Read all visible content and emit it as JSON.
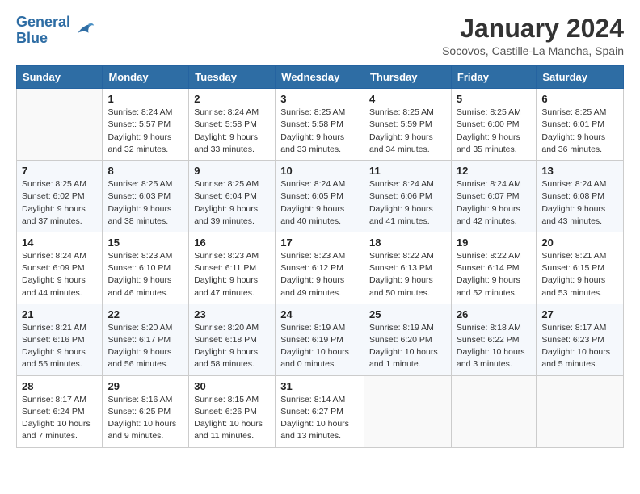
{
  "header": {
    "logo_line1": "General",
    "logo_line2": "Blue",
    "month_title": "January 2024",
    "location": "Socovos, Castille-La Mancha, Spain"
  },
  "weekdays": [
    "Sunday",
    "Monday",
    "Tuesday",
    "Wednesday",
    "Thursday",
    "Friday",
    "Saturday"
  ],
  "weeks": [
    [
      {
        "day": "",
        "info": ""
      },
      {
        "day": "1",
        "info": "Sunrise: 8:24 AM\nSunset: 5:57 PM\nDaylight: 9 hours\nand 32 minutes."
      },
      {
        "day": "2",
        "info": "Sunrise: 8:24 AM\nSunset: 5:58 PM\nDaylight: 9 hours\nand 33 minutes."
      },
      {
        "day": "3",
        "info": "Sunrise: 8:25 AM\nSunset: 5:58 PM\nDaylight: 9 hours\nand 33 minutes."
      },
      {
        "day": "4",
        "info": "Sunrise: 8:25 AM\nSunset: 5:59 PM\nDaylight: 9 hours\nand 34 minutes."
      },
      {
        "day": "5",
        "info": "Sunrise: 8:25 AM\nSunset: 6:00 PM\nDaylight: 9 hours\nand 35 minutes."
      },
      {
        "day": "6",
        "info": "Sunrise: 8:25 AM\nSunset: 6:01 PM\nDaylight: 9 hours\nand 36 minutes."
      }
    ],
    [
      {
        "day": "7",
        "info": "Sunrise: 8:25 AM\nSunset: 6:02 PM\nDaylight: 9 hours\nand 37 minutes."
      },
      {
        "day": "8",
        "info": "Sunrise: 8:25 AM\nSunset: 6:03 PM\nDaylight: 9 hours\nand 38 minutes."
      },
      {
        "day": "9",
        "info": "Sunrise: 8:25 AM\nSunset: 6:04 PM\nDaylight: 9 hours\nand 39 minutes."
      },
      {
        "day": "10",
        "info": "Sunrise: 8:24 AM\nSunset: 6:05 PM\nDaylight: 9 hours\nand 40 minutes."
      },
      {
        "day": "11",
        "info": "Sunrise: 8:24 AM\nSunset: 6:06 PM\nDaylight: 9 hours\nand 41 minutes."
      },
      {
        "day": "12",
        "info": "Sunrise: 8:24 AM\nSunset: 6:07 PM\nDaylight: 9 hours\nand 42 minutes."
      },
      {
        "day": "13",
        "info": "Sunrise: 8:24 AM\nSunset: 6:08 PM\nDaylight: 9 hours\nand 43 minutes."
      }
    ],
    [
      {
        "day": "14",
        "info": "Sunrise: 8:24 AM\nSunset: 6:09 PM\nDaylight: 9 hours\nand 44 minutes."
      },
      {
        "day": "15",
        "info": "Sunrise: 8:23 AM\nSunset: 6:10 PM\nDaylight: 9 hours\nand 46 minutes."
      },
      {
        "day": "16",
        "info": "Sunrise: 8:23 AM\nSunset: 6:11 PM\nDaylight: 9 hours\nand 47 minutes."
      },
      {
        "day": "17",
        "info": "Sunrise: 8:23 AM\nSunset: 6:12 PM\nDaylight: 9 hours\nand 49 minutes."
      },
      {
        "day": "18",
        "info": "Sunrise: 8:22 AM\nSunset: 6:13 PM\nDaylight: 9 hours\nand 50 minutes."
      },
      {
        "day": "19",
        "info": "Sunrise: 8:22 AM\nSunset: 6:14 PM\nDaylight: 9 hours\nand 52 minutes."
      },
      {
        "day": "20",
        "info": "Sunrise: 8:21 AM\nSunset: 6:15 PM\nDaylight: 9 hours\nand 53 minutes."
      }
    ],
    [
      {
        "day": "21",
        "info": "Sunrise: 8:21 AM\nSunset: 6:16 PM\nDaylight: 9 hours\nand 55 minutes."
      },
      {
        "day": "22",
        "info": "Sunrise: 8:20 AM\nSunset: 6:17 PM\nDaylight: 9 hours\nand 56 minutes."
      },
      {
        "day": "23",
        "info": "Sunrise: 8:20 AM\nSunset: 6:18 PM\nDaylight: 9 hours\nand 58 minutes."
      },
      {
        "day": "24",
        "info": "Sunrise: 8:19 AM\nSunset: 6:19 PM\nDaylight: 10 hours\nand 0 minutes."
      },
      {
        "day": "25",
        "info": "Sunrise: 8:19 AM\nSunset: 6:20 PM\nDaylight: 10 hours\nand 1 minute."
      },
      {
        "day": "26",
        "info": "Sunrise: 8:18 AM\nSunset: 6:22 PM\nDaylight: 10 hours\nand 3 minutes."
      },
      {
        "day": "27",
        "info": "Sunrise: 8:17 AM\nSunset: 6:23 PM\nDaylight: 10 hours\nand 5 minutes."
      }
    ],
    [
      {
        "day": "28",
        "info": "Sunrise: 8:17 AM\nSunset: 6:24 PM\nDaylight: 10 hours\nand 7 minutes."
      },
      {
        "day": "29",
        "info": "Sunrise: 8:16 AM\nSunset: 6:25 PM\nDaylight: 10 hours\nand 9 minutes."
      },
      {
        "day": "30",
        "info": "Sunrise: 8:15 AM\nSunset: 6:26 PM\nDaylight: 10 hours\nand 11 minutes."
      },
      {
        "day": "31",
        "info": "Sunrise: 8:14 AM\nSunset: 6:27 PM\nDaylight: 10 hours\nand 13 minutes."
      },
      {
        "day": "",
        "info": ""
      },
      {
        "day": "",
        "info": ""
      },
      {
        "day": "",
        "info": ""
      }
    ]
  ]
}
